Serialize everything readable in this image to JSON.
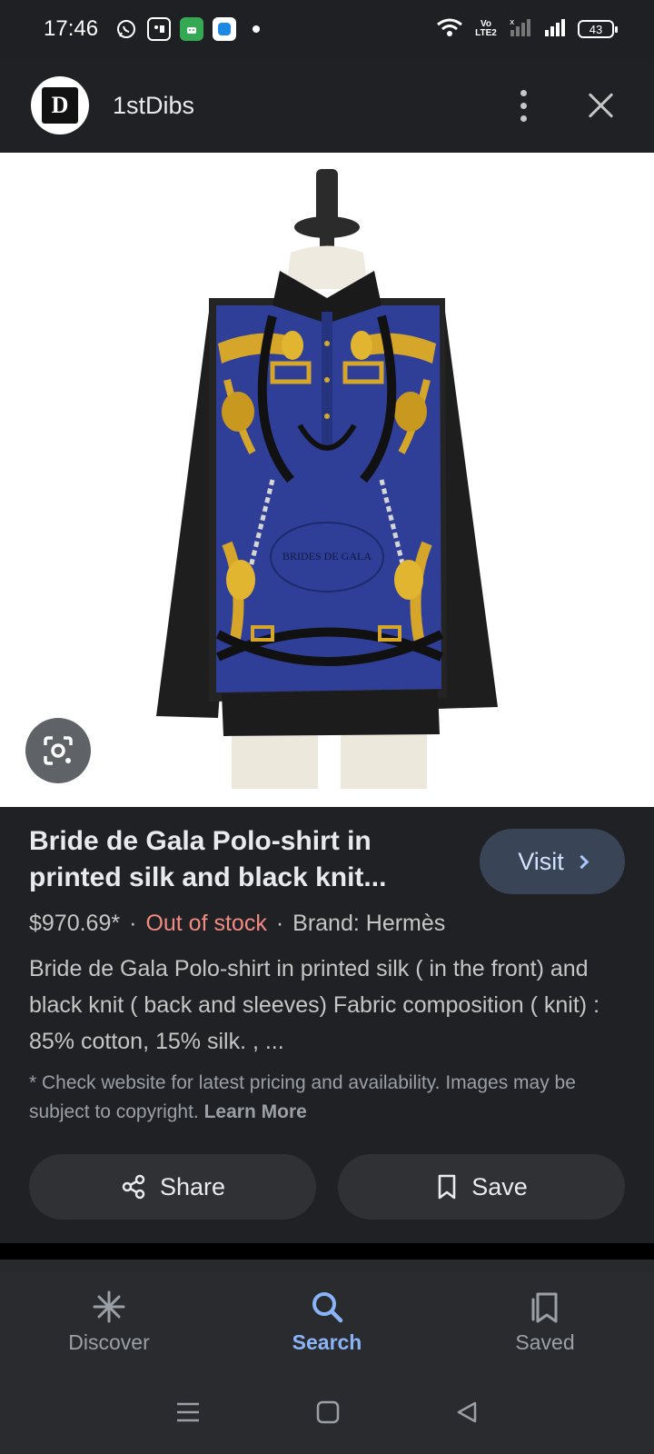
{
  "status_bar": {
    "time": "17:46",
    "battery": "43",
    "volte": "Vo LTE2"
  },
  "header": {
    "site_name": "1stDibs",
    "logo_text": "D"
  },
  "product": {
    "title": "Bride de Gala Polo-shirt in printed silk and black knit...",
    "visit_label": "Visit",
    "price": "$970.69*",
    "stock": "Out of stock",
    "brand": "Brand: Hermès",
    "description": "Bride de Gala Polo-shirt in printed silk ( in the front) and black knit ( back and sleeves) Fabric composition ( knit) : 85% cotton, 15% silk. , ...",
    "disclaimer": "* Check website for latest pricing and availability. Images may be subject to copyright.",
    "learn_more": "Learn More",
    "print_text": "BRIDES DE GALA"
  },
  "actions": {
    "share_label": "Share",
    "save_label": "Save"
  },
  "bottom_nav": {
    "items": [
      {
        "label": "Discover",
        "icon": "asterisk-icon"
      },
      {
        "label": "Search",
        "icon": "search-icon"
      },
      {
        "label": "Saved",
        "icon": "saved-icon"
      }
    ],
    "active": "Search"
  },
  "colors": {
    "accent": "#8ab4f8",
    "out_of_stock": "#f28b82",
    "background": "#202124"
  }
}
